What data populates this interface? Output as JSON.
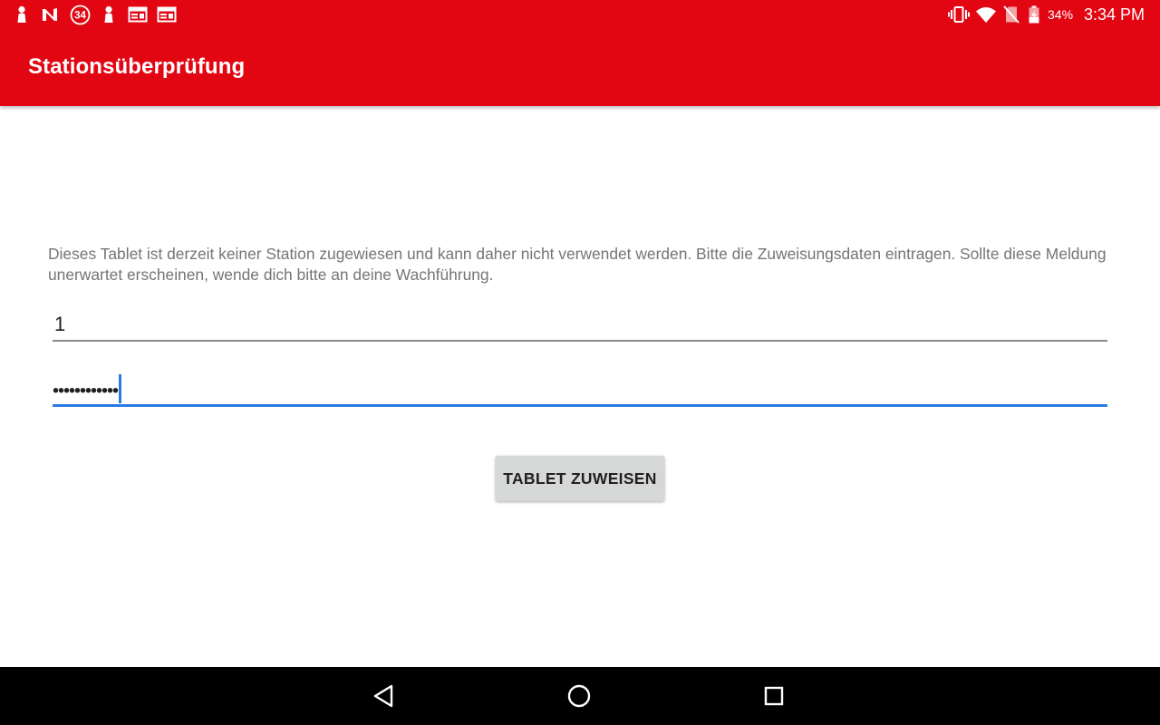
{
  "app": {
    "title": "Stationsüberprüfung",
    "accent_color": "#e20613",
    "focus_color": "#2a7ae4"
  },
  "status_bar": {
    "notification_icons": [
      "person-icon",
      "n-logo-icon",
      "badge-34-icon",
      "person-icon",
      "calendar-icon",
      "calendar-icon"
    ],
    "badge_number": "34",
    "system_icons": [
      "vibrate-icon",
      "wifi-icon",
      "no-sim-icon",
      "battery-charging-icon"
    ],
    "battery_text": "34%",
    "clock": "3:34 PM"
  },
  "main": {
    "message": "Dieses Tablet ist derzeit keiner Station zugewiesen und kann daher nicht verwendet werden. Bitte die Zuweisungsdaten eintragen. Sollte diese Meldung unerwartet erscheinen, wende dich bitte an deine Wachführung.",
    "station_field": {
      "value": "1"
    },
    "password_field": {
      "value": "••••••••••••",
      "focused": true
    },
    "assign_button_label": "TABLET ZUWEISEN"
  },
  "nav_bar": {
    "buttons": [
      "back-icon",
      "home-icon",
      "recents-icon"
    ]
  }
}
